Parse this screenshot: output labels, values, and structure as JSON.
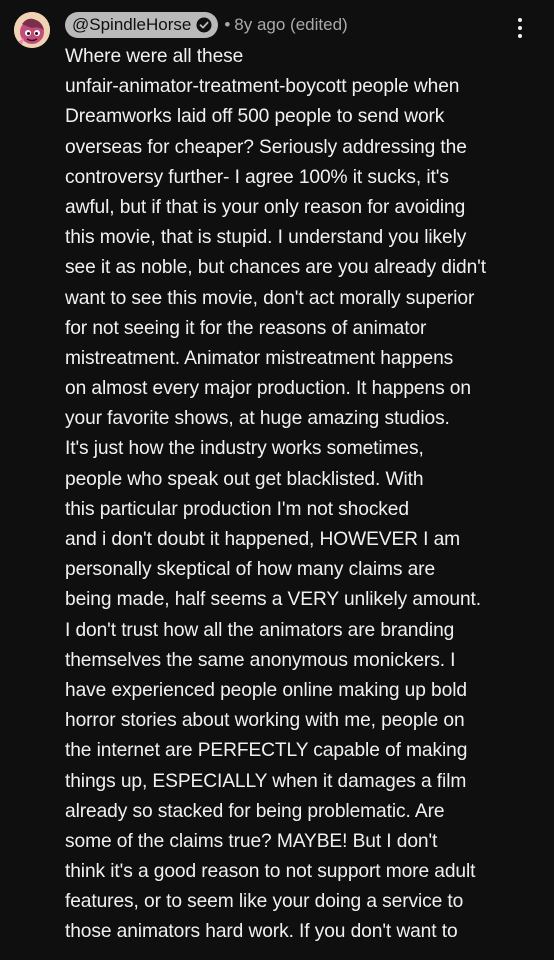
{
  "comment": {
    "author": "@SpindleHorse",
    "separator": "•",
    "meta": "8y ago (edited)",
    "lines": [
      "Where were all these",
      "unfair-animator-treatment-boycott people when",
      "Dreamworks laid off 500 people to send work",
      "overseas for cheaper? Seriously addressing the",
      "controversy further- I agree 100% it sucks, it's",
      "awful, but if that is your only reason for avoiding",
      "this movie, that is stupid. I understand you likely",
      "see it as noble, but chances are you already didn't",
      "want to see this movie, don't act morally superior",
      "for not seeing it for the reasons of animator",
      "mistreatment. Animator mistreatment happens",
      "on almost every major production. It happens on",
      "your favorite shows, at huge amazing studios.",
      "It's just how the industry works sometimes,",
      "people who speak out get blacklisted. With",
      "this particular production I'm not shocked",
      "and i don't doubt it happened, HOWEVER I am",
      "personally skeptical of how many claims are",
      "being made, half seems a VERY unlikely amount.",
      "I don't trust how all the animators are branding",
      "themselves the same anonymous monickers. I",
      "have experienced people online making up bold",
      "horror stories about working with me, people on",
      "the internet are PERFECTLY capable of making",
      "things up, ESPECIALLY when it damages a film",
      "already so stacked for being problematic. Are",
      "some of the claims true? MAYBE! But I don't",
      "think it's a good reason to not support more adult",
      "features, or to seem like your doing a service to",
      "those animators hard work. If you don't want to"
    ]
  },
  "icons": {
    "avatar": "avatar-image",
    "verified": "verified-check-icon",
    "more": "more-vert-icon"
  },
  "colors": {
    "background": "#0f0f0f",
    "text": "#f1f1f1",
    "secondary_text": "#aaaaaa",
    "author_chip": "#b9b9b9"
  }
}
